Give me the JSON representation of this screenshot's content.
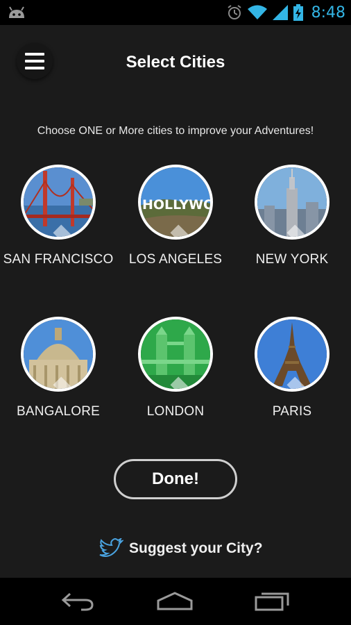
{
  "status_bar": {
    "time": "8:48",
    "icons": [
      "android-icon",
      "alarm-icon",
      "wifi-icon",
      "signal-icon",
      "battery-charging-icon"
    ]
  },
  "header": {
    "title": "Select Cities",
    "menu_icon": "hamburger-menu-icon"
  },
  "subtitle": "Choose ONE or More cities to improve your Adventures!",
  "cities": [
    {
      "name": "SAN FRANCISCO",
      "image": "golden-gate-bridge"
    },
    {
      "name": "LOS ANGELES",
      "image": "hollywood-sign"
    },
    {
      "name": "NEW YORK",
      "image": "empire-state-building"
    },
    {
      "name": "BANGALORE",
      "image": "vidhana-soudha"
    },
    {
      "name": "LONDON",
      "image": "tower-bridge"
    },
    {
      "name": "PARIS",
      "image": "eiffel-tower"
    }
  ],
  "done_label": "Done!",
  "suggest": {
    "icon": "twitter-bird-icon",
    "label": "Suggest your City?",
    "accent": "#4aa3e0"
  },
  "nav_bar": {
    "buttons": [
      "back-icon",
      "home-icon",
      "recent-apps-icon"
    ]
  },
  "colors": {
    "background": "#1b1b1b",
    "status_time": "#33b5e5",
    "london_tint": "#2ea84a"
  }
}
